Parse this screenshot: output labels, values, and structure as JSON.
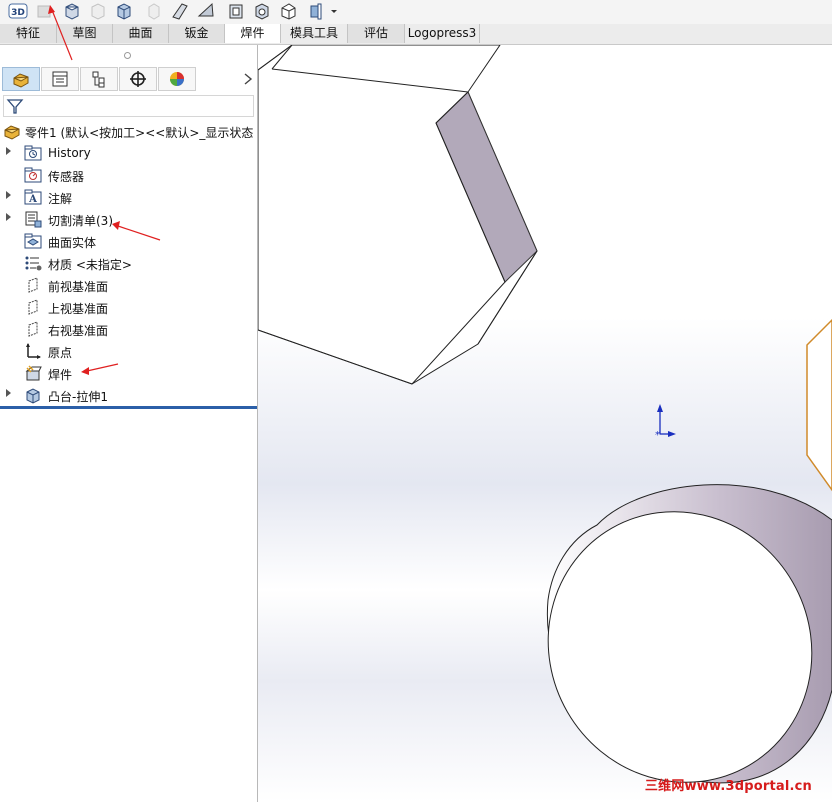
{
  "toolbar": {
    "buttons": [
      {
        "icon": "3d-view-icon",
        "label": "3D"
      },
      {
        "icon": "disabled-part-icon"
      },
      {
        "icon": "extrude-feature-icon"
      },
      {
        "icon": "disabled-feature-icon"
      },
      {
        "icon": "solid-body-icon"
      },
      {
        "icon": "disabled-body-icon"
      },
      {
        "icon": "sheet-tool-icon"
      },
      {
        "icon": "wedge-tool-icon"
      },
      {
        "icon": "panel-tool-icon"
      },
      {
        "icon": "gear-part-icon"
      },
      {
        "icon": "box-tool-icon"
      },
      {
        "icon": "dropdown-tool-icon"
      }
    ]
  },
  "command_tabs": [
    "特征",
    "草图",
    "曲面",
    "钣金",
    "焊件",
    "模具工具",
    "评估",
    "Logopress3"
  ],
  "active_tab": "焊件",
  "panel_tabs": [
    "feature-manager-icon",
    "property-manager-icon",
    "configuration-manager-icon",
    "dimxpert-icon",
    "display-manager-icon"
  ],
  "tree": {
    "root_label": "零件1  (默认<按加工><<默认>_显示状态",
    "items": [
      {
        "label": "History",
        "icon": "history-folder-icon",
        "expandable": true
      },
      {
        "label": "传感器",
        "icon": "sensor-icon",
        "expandable": false
      },
      {
        "label": "注解",
        "icon": "annotation-icon",
        "expandable": true
      },
      {
        "label": "切割清单(3)",
        "icon": "cut-list-icon",
        "expandable": true
      },
      {
        "label": "曲面实体",
        "icon": "surface-body-icon",
        "expandable": false
      },
      {
        "label": "材质 <未指定>",
        "icon": "material-icon",
        "expandable": false
      },
      {
        "label": "前视基准面",
        "icon": "plane-icon",
        "expandable": false
      },
      {
        "label": "上视基准面",
        "icon": "plane-icon",
        "expandable": false
      },
      {
        "label": "右视基准面",
        "icon": "plane-icon",
        "expandable": false
      },
      {
        "label": "原点",
        "icon": "origin-icon",
        "expandable": false
      },
      {
        "label": "焊件",
        "icon": "weldment-icon",
        "expandable": false
      },
      {
        "label": "凸台-拉伸1",
        "icon": "boss-extrude-icon",
        "expandable": true
      }
    ]
  },
  "watermark": "三维网www.3dportal.cn",
  "colors": {
    "annotation_arrow": "#e02020",
    "rollback_bar": "#2b5fa8",
    "selected_edge": "#d08a2a",
    "origin_axis": "#1a2fbf"
  }
}
